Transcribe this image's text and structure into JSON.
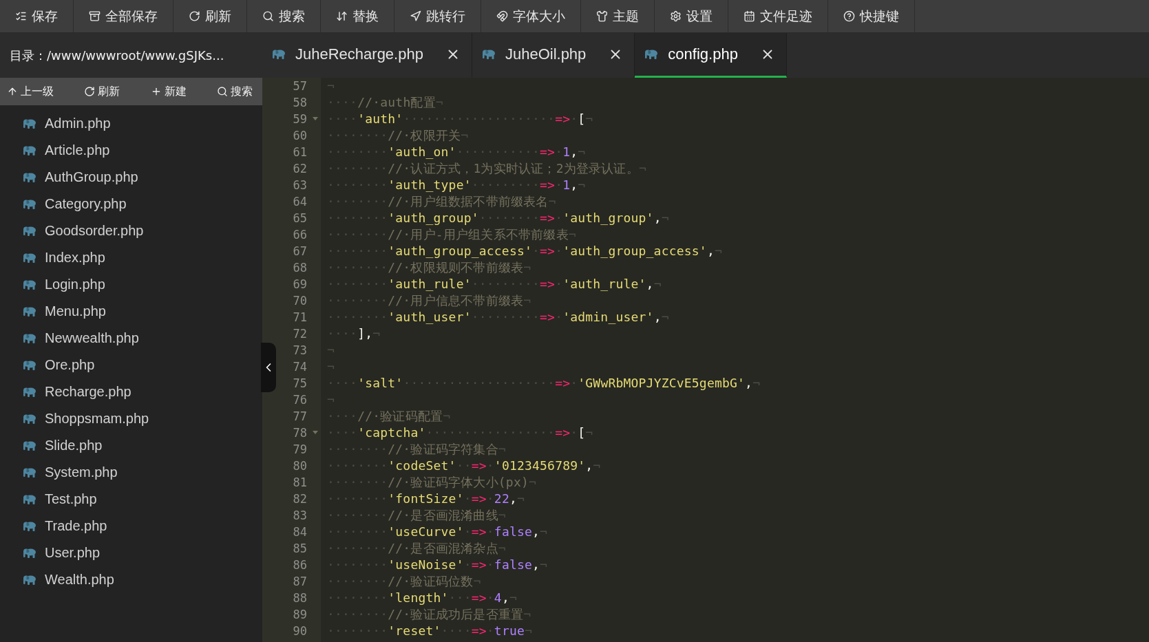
{
  "toolbar": [
    "保存",
    "全部保存",
    "刷新",
    "搜索",
    "替换",
    "跳转行",
    "字体大小",
    "主题",
    "设置",
    "文件足迹",
    "快捷键"
  ],
  "sidebar": {
    "path": "目录：/www/wwwroot/www.gSJKs...",
    "actions": [
      "上一级",
      "刷新",
      "新建",
      "搜索"
    ],
    "files": [
      {
        "name": "Admin.php"
      },
      {
        "name": "Article.php"
      },
      {
        "name": "AuthGroup.php"
      },
      {
        "name": "Category.php"
      },
      {
        "name": "Goodsorder.php"
      },
      {
        "name": "Index.php"
      },
      {
        "name": "Login.php"
      },
      {
        "name": "Menu.php"
      },
      {
        "name": "Newwealth.php"
      },
      {
        "name": "Ore.php"
      },
      {
        "name": "Recharge.php"
      },
      {
        "name": "Shoppsmam.php"
      },
      {
        "name": "Slide.php"
      },
      {
        "name": "System.php"
      },
      {
        "name": "Test.php"
      },
      {
        "name": "Trade.php"
      },
      {
        "name": "User.php"
      },
      {
        "name": "Wealth.php"
      }
    ]
  },
  "tabs": [
    {
      "label": "JuheRecharge.php",
      "selected": false
    },
    {
      "label": "JuheOil.php",
      "selected": false
    },
    {
      "label": "config.php",
      "selected": true
    }
  ],
  "editor": {
    "lines": [
      {
        "number": "57",
        "foldable": false,
        "tokens": [
          {
            "kind": "ws",
            "text": "¬"
          }
        ]
      },
      {
        "number": "58",
        "foldable": false,
        "tokens": [
          {
            "kind": "ws",
            "text": "····"
          },
          {
            "kind": "comment",
            "text": "//·auth配置"
          },
          {
            "kind": "ws",
            "text": "¬"
          }
        ]
      },
      {
        "number": "59",
        "foldable": true,
        "tokens": [
          {
            "kind": "ws",
            "text": "····"
          },
          {
            "kind": "string",
            "text": "'auth'"
          },
          {
            "kind": "ws",
            "text": "····················"
          },
          {
            "kind": "op",
            "text": "=>"
          },
          {
            "kind": "ws",
            "text": "·"
          },
          {
            "kind": "punct",
            "text": "["
          },
          {
            "kind": "ws",
            "text": "¬"
          }
        ]
      },
      {
        "number": "60",
        "foldable": false,
        "tokens": [
          {
            "kind": "ws",
            "text": "········"
          },
          {
            "kind": "comment",
            "text": "//·权限开关"
          },
          {
            "kind": "ws",
            "text": "¬"
          }
        ]
      },
      {
        "number": "61",
        "foldable": false,
        "tokens": [
          {
            "kind": "ws",
            "text": "········"
          },
          {
            "kind": "string",
            "text": "'auth_on'"
          },
          {
            "kind": "ws",
            "text": "···········"
          },
          {
            "kind": "op",
            "text": "=>"
          },
          {
            "kind": "ws",
            "text": "·"
          },
          {
            "kind": "number",
            "text": "1"
          },
          {
            "kind": "punct",
            "text": ","
          },
          {
            "kind": "ws",
            "text": "¬"
          }
        ]
      },
      {
        "number": "62",
        "foldable": false,
        "tokens": [
          {
            "kind": "ws",
            "text": "········"
          },
          {
            "kind": "comment",
            "text": "//·认证方式，1为实时认证；2为登录认证。"
          },
          {
            "kind": "ws",
            "text": "¬"
          }
        ]
      },
      {
        "number": "63",
        "foldable": false,
        "tokens": [
          {
            "kind": "ws",
            "text": "········"
          },
          {
            "kind": "string",
            "text": "'auth_type'"
          },
          {
            "kind": "ws",
            "text": "·········"
          },
          {
            "kind": "op",
            "text": "=>"
          },
          {
            "kind": "ws",
            "text": "·"
          },
          {
            "kind": "number",
            "text": "1"
          },
          {
            "kind": "punct",
            "text": ","
          },
          {
            "kind": "ws",
            "text": "¬"
          }
        ]
      },
      {
        "number": "64",
        "foldable": false,
        "tokens": [
          {
            "kind": "ws",
            "text": "········"
          },
          {
            "kind": "comment",
            "text": "//·用户组数据不带前缀表名"
          },
          {
            "kind": "ws",
            "text": "¬"
          }
        ]
      },
      {
        "number": "65",
        "foldable": false,
        "tokens": [
          {
            "kind": "ws",
            "text": "········"
          },
          {
            "kind": "string",
            "text": "'auth_group'"
          },
          {
            "kind": "ws",
            "text": "········"
          },
          {
            "kind": "op",
            "text": "=>"
          },
          {
            "kind": "ws",
            "text": "·"
          },
          {
            "kind": "string",
            "text": "'auth_group'"
          },
          {
            "kind": "punct",
            "text": ","
          },
          {
            "kind": "ws",
            "text": "¬"
          }
        ]
      },
      {
        "number": "66",
        "foldable": false,
        "tokens": [
          {
            "kind": "ws",
            "text": "········"
          },
          {
            "kind": "comment",
            "text": "//·用户-用户组关系不带前缀表"
          },
          {
            "kind": "ws",
            "text": "¬"
          }
        ]
      },
      {
        "number": "67",
        "foldable": false,
        "tokens": [
          {
            "kind": "ws",
            "text": "········"
          },
          {
            "kind": "string",
            "text": "'auth_group_access'"
          },
          {
            "kind": "ws",
            "text": "·"
          },
          {
            "kind": "op",
            "text": "=>"
          },
          {
            "kind": "ws",
            "text": "·"
          },
          {
            "kind": "string",
            "text": "'auth_group_access'"
          },
          {
            "kind": "punct",
            "text": ","
          },
          {
            "kind": "ws",
            "text": "¬"
          }
        ]
      },
      {
        "number": "68",
        "foldable": false,
        "tokens": [
          {
            "kind": "ws",
            "text": "········"
          },
          {
            "kind": "comment",
            "text": "//·权限规则不带前缀表"
          },
          {
            "kind": "ws",
            "text": "¬"
          }
        ]
      },
      {
        "number": "69",
        "foldable": false,
        "tokens": [
          {
            "kind": "ws",
            "text": "········"
          },
          {
            "kind": "string",
            "text": "'auth_rule'"
          },
          {
            "kind": "ws",
            "text": "·········"
          },
          {
            "kind": "op",
            "text": "=>"
          },
          {
            "kind": "ws",
            "text": "·"
          },
          {
            "kind": "string",
            "text": "'auth_rule'"
          },
          {
            "kind": "punct",
            "text": ","
          },
          {
            "kind": "ws",
            "text": "¬"
          }
        ]
      },
      {
        "number": "70",
        "foldable": false,
        "tokens": [
          {
            "kind": "ws",
            "text": "········"
          },
          {
            "kind": "comment",
            "text": "//·用户信息不带前缀表"
          },
          {
            "kind": "ws",
            "text": "¬"
          }
        ]
      },
      {
        "number": "71",
        "foldable": false,
        "tokens": [
          {
            "kind": "ws",
            "text": "········"
          },
          {
            "kind": "string",
            "text": "'auth_user'"
          },
          {
            "kind": "ws",
            "text": "·········"
          },
          {
            "kind": "op",
            "text": "=>"
          },
          {
            "kind": "ws",
            "text": "·"
          },
          {
            "kind": "string",
            "text": "'admin_user'"
          },
          {
            "kind": "punct",
            "text": ","
          },
          {
            "kind": "ws",
            "text": "¬"
          }
        ]
      },
      {
        "number": "72",
        "foldable": false,
        "tokens": [
          {
            "kind": "ws",
            "text": "····"
          },
          {
            "kind": "punct",
            "text": "],"
          },
          {
            "kind": "ws",
            "text": "¬"
          }
        ]
      },
      {
        "number": "73",
        "foldable": false,
        "tokens": [
          {
            "kind": "ws",
            "text": "¬"
          }
        ]
      },
      {
        "number": "74",
        "foldable": false,
        "tokens": [
          {
            "kind": "ws",
            "text": "¬"
          }
        ]
      },
      {
        "number": "75",
        "foldable": false,
        "tokens": [
          {
            "kind": "ws",
            "text": "····"
          },
          {
            "kind": "string",
            "text": "'salt'"
          },
          {
            "kind": "ws",
            "text": "····················"
          },
          {
            "kind": "op",
            "text": "=>"
          },
          {
            "kind": "ws",
            "text": "·"
          },
          {
            "kind": "string",
            "text": "'GWwRbMOPJYZCvE5gembG'"
          },
          {
            "kind": "punct",
            "text": ","
          },
          {
            "kind": "ws",
            "text": "¬"
          }
        ]
      },
      {
        "number": "76",
        "foldable": false,
        "tokens": [
          {
            "kind": "ws",
            "text": "¬"
          }
        ]
      },
      {
        "number": "77",
        "foldable": false,
        "tokens": [
          {
            "kind": "ws",
            "text": "····"
          },
          {
            "kind": "comment",
            "text": "//·验证码配置"
          },
          {
            "kind": "ws",
            "text": "¬"
          }
        ]
      },
      {
        "number": "78",
        "foldable": true,
        "tokens": [
          {
            "kind": "ws",
            "text": "····"
          },
          {
            "kind": "string",
            "text": "'captcha'"
          },
          {
            "kind": "ws",
            "text": "·················"
          },
          {
            "kind": "op",
            "text": "=>"
          },
          {
            "kind": "ws",
            "text": "·"
          },
          {
            "kind": "punct",
            "text": "["
          },
          {
            "kind": "ws",
            "text": "¬"
          }
        ]
      },
      {
        "number": "79",
        "foldable": false,
        "tokens": [
          {
            "kind": "ws",
            "text": "········"
          },
          {
            "kind": "comment",
            "text": "//·验证码字符集合"
          },
          {
            "kind": "ws",
            "text": "¬"
          }
        ]
      },
      {
        "number": "80",
        "foldable": false,
        "tokens": [
          {
            "kind": "ws",
            "text": "········"
          },
          {
            "kind": "string",
            "text": "'codeSet'"
          },
          {
            "kind": "ws",
            "text": "··"
          },
          {
            "kind": "op",
            "text": "=>"
          },
          {
            "kind": "ws",
            "text": "·"
          },
          {
            "kind": "string",
            "text": "'0123456789'"
          },
          {
            "kind": "punct",
            "text": ","
          },
          {
            "kind": "ws",
            "text": "¬"
          }
        ]
      },
      {
        "number": "81",
        "foldable": false,
        "tokens": [
          {
            "kind": "ws",
            "text": "········"
          },
          {
            "kind": "comment",
            "text": "//·验证码字体大小(px)"
          },
          {
            "kind": "ws",
            "text": "¬"
          }
        ]
      },
      {
        "number": "82",
        "foldable": false,
        "tokens": [
          {
            "kind": "ws",
            "text": "········"
          },
          {
            "kind": "string",
            "text": "'fontSize'"
          },
          {
            "kind": "ws",
            "text": "·"
          },
          {
            "kind": "op",
            "text": "=>"
          },
          {
            "kind": "ws",
            "text": "·"
          },
          {
            "kind": "number",
            "text": "22"
          },
          {
            "kind": "punct",
            "text": ","
          },
          {
            "kind": "ws",
            "text": "¬"
          }
        ]
      },
      {
        "number": "83",
        "foldable": false,
        "tokens": [
          {
            "kind": "ws",
            "text": "········"
          },
          {
            "kind": "comment",
            "text": "//·是否画混淆曲线"
          },
          {
            "kind": "ws",
            "text": "¬"
          }
        ]
      },
      {
        "number": "84",
        "foldable": false,
        "tokens": [
          {
            "kind": "ws",
            "text": "········"
          },
          {
            "kind": "string",
            "text": "'useCurve'"
          },
          {
            "kind": "ws",
            "text": "·"
          },
          {
            "kind": "op",
            "text": "=>"
          },
          {
            "kind": "ws",
            "text": "·"
          },
          {
            "kind": "number",
            "text": "false"
          },
          {
            "kind": "punct",
            "text": ","
          },
          {
            "kind": "ws",
            "text": "¬"
          }
        ]
      },
      {
        "number": "85",
        "foldable": false,
        "tokens": [
          {
            "kind": "ws",
            "text": "········"
          },
          {
            "kind": "comment",
            "text": "//·是否画混淆杂点"
          },
          {
            "kind": "ws",
            "text": "¬"
          }
        ]
      },
      {
        "number": "86",
        "foldable": false,
        "tokens": [
          {
            "kind": "ws",
            "text": "········"
          },
          {
            "kind": "string",
            "text": "'useNoise'"
          },
          {
            "kind": "ws",
            "text": "·"
          },
          {
            "kind": "op",
            "text": "=>"
          },
          {
            "kind": "ws",
            "text": "·"
          },
          {
            "kind": "number",
            "text": "false"
          },
          {
            "kind": "punct",
            "text": ","
          },
          {
            "kind": "ws",
            "text": "¬"
          }
        ]
      },
      {
        "number": "87",
        "foldable": false,
        "tokens": [
          {
            "kind": "ws",
            "text": "········"
          },
          {
            "kind": "comment",
            "text": "//·验证码位数"
          },
          {
            "kind": "ws",
            "text": "¬"
          }
        ]
      },
      {
        "number": "88",
        "foldable": false,
        "tokens": [
          {
            "kind": "ws",
            "text": "········"
          },
          {
            "kind": "string",
            "text": "'length'"
          },
          {
            "kind": "ws",
            "text": "···"
          },
          {
            "kind": "op",
            "text": "=>"
          },
          {
            "kind": "ws",
            "text": "·"
          },
          {
            "kind": "number",
            "text": "4"
          },
          {
            "kind": "punct",
            "text": ","
          },
          {
            "kind": "ws",
            "text": "¬"
          }
        ]
      },
      {
        "number": "89",
        "foldable": false,
        "tokens": [
          {
            "kind": "ws",
            "text": "········"
          },
          {
            "kind": "comment",
            "text": "//·验证成功后是否重置"
          },
          {
            "kind": "ws",
            "text": "¬"
          }
        ]
      },
      {
        "number": "90",
        "foldable": false,
        "tokens": [
          {
            "kind": "ws",
            "text": "········"
          },
          {
            "kind": "string",
            "text": "'reset'"
          },
          {
            "kind": "ws",
            "text": "····"
          },
          {
            "kind": "op",
            "text": "=>"
          },
          {
            "kind": "ws",
            "text": "·"
          },
          {
            "kind": "number",
            "text": "true"
          },
          {
            "kind": "ws",
            "text": "¬"
          }
        ]
      }
    ]
  }
}
